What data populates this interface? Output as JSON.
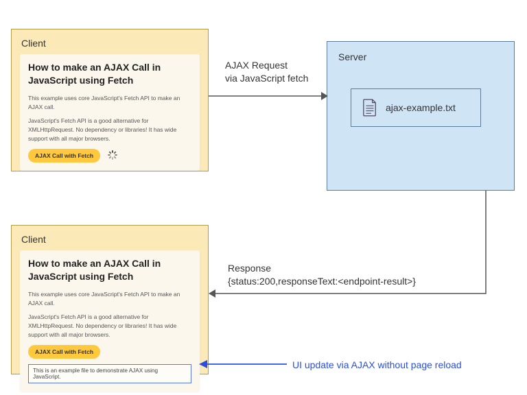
{
  "client": {
    "title": "Client",
    "heading": "How to make an AJAX Call in JavaScript using Fetch",
    "para1": "This example uses core JavaScript's Fetch API to make an AJAX call.",
    "para2": "JavaScript's Fetch API is a good alternative for XMLHttpRequest. No dependency or libraries! It has wide support with all major browsers.",
    "button": "AJAX Call with Fetch",
    "result_text": "This is an example file to demonstrate AJAX using JavaScript."
  },
  "server": {
    "title": "Server",
    "file": "ajax-example.txt"
  },
  "labels": {
    "request_line1": "AJAX Request",
    "request_line2": "via JavaScript fetch",
    "response_line1": "Response",
    "response_line2": "{status:200,responseText:<endpoint-result>}",
    "ui_update": "UI update via AJAX without page reload"
  }
}
